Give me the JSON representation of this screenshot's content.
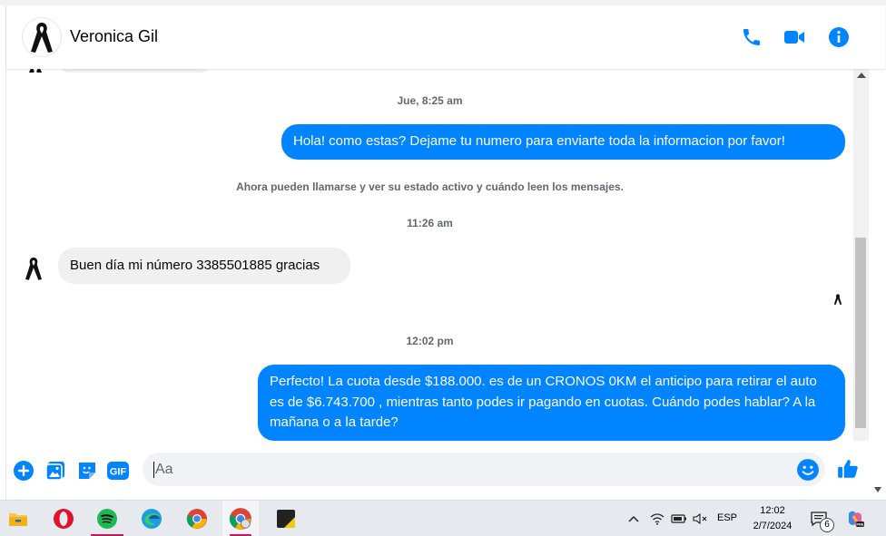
{
  "header": {
    "contact_name": "Veronica Gil"
  },
  "conversation": {
    "timestamp_1": "Jue, 8:25 am",
    "message_1": "Hola! como estas? Dejame tu numero para enviarte toda la informacion por favor!",
    "notice": "Ahora pueden llamarse y ver su estado activo y cuándo leen los mensajes.",
    "timestamp_2": "11:26 am",
    "message_2": "Buen día mi número 3385501885 gracias",
    "timestamp_3": "12:02 pm",
    "message_3": "Perfecto! La cuota desde $188.000. es de un CRONOS 0KM el anticipo para retirar el auto es de $6.743.700 , mientras tanto podes ir pagando en cuotas. Cuándo podes hablar? A la mañana o a la tarde?"
  },
  "composer": {
    "placeholder": "Aa"
  },
  "taskbar": {
    "language": "ESP",
    "time": "12:02",
    "date": "2/7/2024",
    "notification_count": "6",
    "apps": [
      "file-explorer",
      "opera",
      "spotify",
      "edge",
      "chrome",
      "chrome-profile",
      "sticky-app"
    ]
  },
  "colors": {
    "accent": "#0084ff",
    "incoming_bubble": "#f0f0f0",
    "taskbar": "#e6e9ee"
  }
}
